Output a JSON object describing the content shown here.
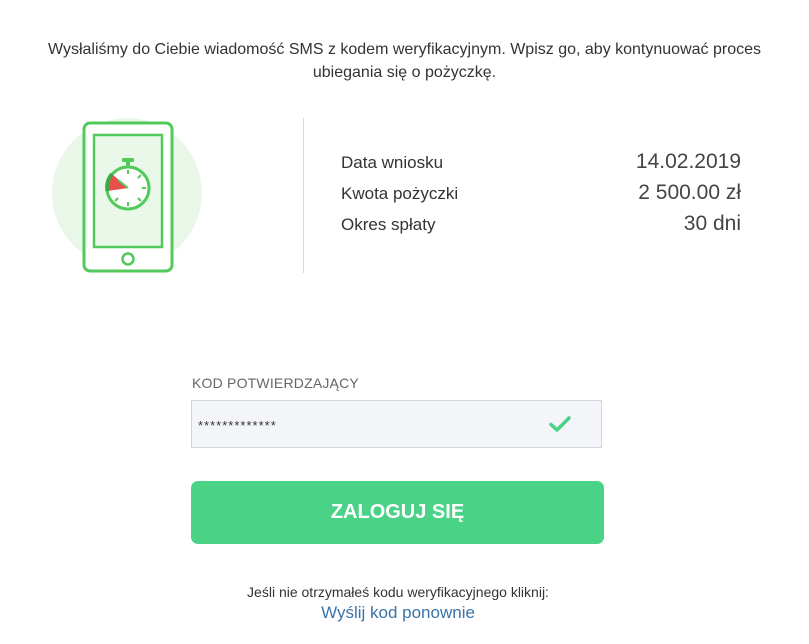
{
  "intro": {
    "line1": "Wysłaliśmy do Ciebie wiadomość SMS z kodem weryfikacyjnym. Wpisz go, aby kontynuować proces",
    "line2": "ubiegania się o pożyczkę."
  },
  "illustration": {
    "icon": "phone-stopwatch-icon",
    "colors": {
      "circle": "#e8f7e8",
      "phone_outline": "#52c95a",
      "stopwatch": "#52c95a",
      "slice_red": "#e9504a"
    }
  },
  "details": [
    {
      "label": "Data wniosku",
      "value": "14.02.2019"
    },
    {
      "label": "Kwota pożyczki",
      "value": "2 500.00 zł"
    },
    {
      "label": "Okres spłaty",
      "value": "30 dni"
    }
  ],
  "code": {
    "label": "KOD POTWIERDZAJĄCY",
    "value": "*************",
    "valid_icon": "check-icon",
    "valid_color": "#4ad286"
  },
  "login_button": {
    "label": "ZALOGUJ SIĘ",
    "color": "#4ad286"
  },
  "resend": {
    "text": "Jeśli nie otrzymałeś kodu weryfikacyjnego kliknij:",
    "link": "Wyślij kod ponownie",
    "link_color": "#3a73a8"
  }
}
